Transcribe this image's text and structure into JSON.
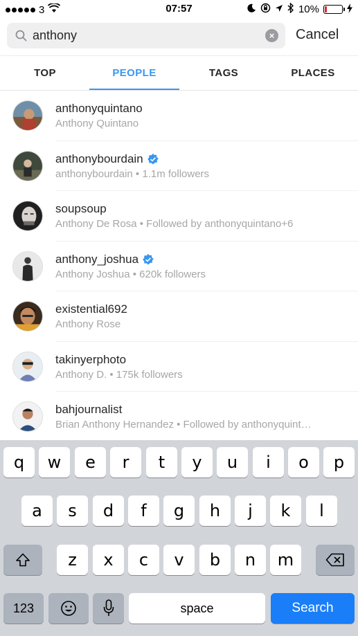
{
  "status_bar": {
    "carrier": "3",
    "time": "07:57",
    "battery": "10%",
    "battery_level": 0.1
  },
  "search": {
    "query": "anthony",
    "cancel_label": "Cancel"
  },
  "tabs": [
    {
      "label": "TOP",
      "active": false
    },
    {
      "label": "PEOPLE",
      "active": true
    },
    {
      "label": "TAGS",
      "active": false
    },
    {
      "label": "PLACES",
      "active": false
    }
  ],
  "results": [
    {
      "username": "anthonyquintano",
      "subtitle": "Anthony Quintano",
      "verified": false
    },
    {
      "username": "anthonybourdain",
      "subtitle": "anthonybourdain • 1.1m followers",
      "verified": true
    },
    {
      "username": "soupsoup",
      "subtitle": "Anthony De Rosa • Followed by anthonyquintano+6",
      "verified": false
    },
    {
      "username": "anthony_joshua",
      "subtitle": "Anthony Joshua • 620k followers",
      "verified": true
    },
    {
      "username": "existential692",
      "subtitle": "Anthony Rose",
      "verified": false
    },
    {
      "username": "takinyerphoto",
      "subtitle": "Anthony D. • 175k followers",
      "verified": false
    },
    {
      "username": "bahjournalist",
      "subtitle": "Brian Anthony Hernandez • Followed by anthonyquint…",
      "verified": false
    }
  ],
  "keyboard": {
    "row1": [
      "q",
      "w",
      "e",
      "r",
      "t",
      "y",
      "u",
      "i",
      "o",
      "p"
    ],
    "row2": [
      "a",
      "s",
      "d",
      "f",
      "g",
      "h",
      "j",
      "k",
      "l"
    ],
    "row3": [
      "z",
      "x",
      "c",
      "v",
      "b",
      "n",
      "m"
    ],
    "numbers_label": "123",
    "space_label": "space",
    "search_label": "Search"
  },
  "colors": {
    "accent": "#3897f0",
    "search_key": "#1a7ef9",
    "battery_low": "#e0282e"
  }
}
